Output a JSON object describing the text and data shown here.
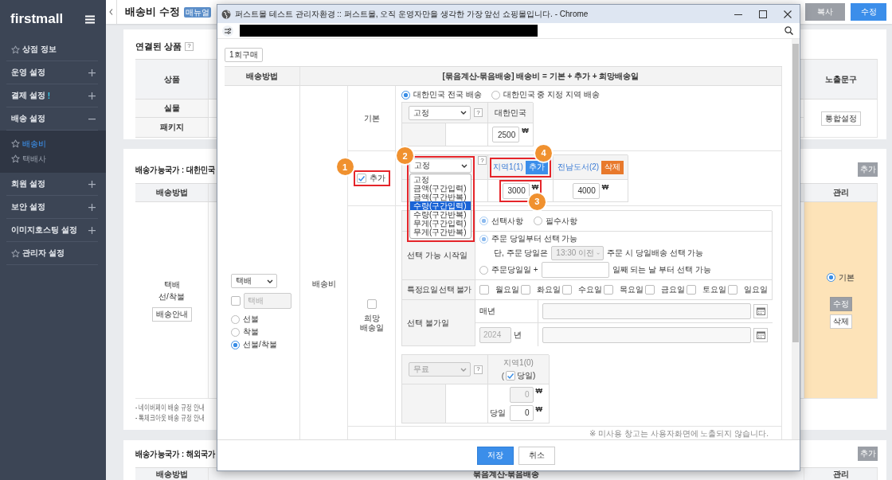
{
  "sidebar": {
    "logo": "firstmall",
    "items": [
      {
        "kind": "link",
        "label": "상점 정보"
      },
      {
        "kind": "group",
        "label": "운영 설정",
        "expanded": false
      },
      {
        "kind": "group",
        "label": "결제 설정",
        "alert": "!",
        "expanded": false
      },
      {
        "kind": "group",
        "label": "배송 설정",
        "expanded": true,
        "children": [
          {
            "label": "배송비",
            "selected": true
          },
          {
            "label": "택배사",
            "selected": false
          }
        ]
      },
      {
        "kind": "group",
        "label": "회원 설정",
        "expanded": false
      },
      {
        "kind": "group",
        "label": "보안 설정",
        "expanded": false
      },
      {
        "kind": "group",
        "label": "이미지호스팅 설정",
        "expanded": false
      },
      {
        "kind": "link",
        "label": "관리자 설정"
      }
    ]
  },
  "header": {
    "title": "배송비 수정",
    "badge": "매뉴얼",
    "buttons": [
      {
        "label": "복사",
        "kind": "secondary"
      },
      {
        "label": "수정",
        "kind": "primary"
      }
    ]
  },
  "linked_products": {
    "title": "연결된 상품",
    "help": "?",
    "columns": [
      "상품",
      "노출문구"
    ],
    "rows": [
      "실물",
      "패키지"
    ],
    "button": "통합설정"
  },
  "domestic": {
    "title": "배송가능국가 : 대한민국",
    "add_button": "추가",
    "columns": [
      "배송방법",
      "관리"
    ],
    "method": {
      "name": "택배",
      "payment": "선/착불",
      "guide_button": "배송안내"
    },
    "manage": {
      "default_option": {
        "label": "기본",
        "selected": true
      },
      "buttons": [
        {
          "label": "수정",
          "kind": "secondary"
        },
        {
          "label": "삭제",
          "kind": "plain"
        }
      ]
    },
    "notes": [
      "- 네이버페이 배송 규정 안내",
      "- 톡체크아웃 배송 규정 안내"
    ]
  },
  "overseas": {
    "title": "배송가능국가 : 해외국가",
    "add_button": "추가",
    "columns": [
      "배송방법",
      "묶음계산-묶음배송",
      "관리"
    ]
  },
  "popup": {
    "title": "퍼스트몰 테스트 관리자환경 :: 퍼스트몰, 오직 운영자만을 생각한 가장 앞선 쇼핑몰입니다. - Chrome",
    "purchase_select": "1회구매",
    "columns": [
      "배송방법",
      "[묶음계산-묶음배송] 배송비 = 기본 + 추가 + 희망배송일"
    ],
    "method": {
      "select": "택배",
      "custom_checked": false,
      "custom_value": "택배",
      "custom_disabled": true,
      "payment_options": [
        {
          "label": "선불",
          "selected": false
        },
        {
          "label": "착불",
          "selected": false
        },
        {
          "label": "선불/착불",
          "selected": true
        }
      ]
    },
    "fee_label": "배송비",
    "basic": {
      "label": "기본",
      "scope_options": [
        {
          "label": "대한민국 전국 배송",
          "selected": true
        },
        {
          "label": "대한민국 중 지정 지역 배송",
          "selected": false
        }
      ],
      "type_select": "고정",
      "help": "?",
      "region": "대한민국",
      "amount": "2500",
      "currency": "₩"
    },
    "extra": {
      "label": "추가",
      "checked": true,
      "type_select": "고정",
      "help": "?",
      "dropdown_open": true,
      "type_options": [
        {
          "label": "고정",
          "selected": false
        },
        {
          "label": "금액(구간입력)",
          "selected": false
        },
        {
          "label": "금액(구간반복)",
          "selected": false
        },
        {
          "label": "수량(구간입력)",
          "selected": true
        },
        {
          "label": "수량(구간반복)",
          "selected": false
        },
        {
          "label": "무게(구간입력)",
          "selected": false
        },
        {
          "label": "무게(구간반복)",
          "selected": false
        }
      ],
      "regions": [
        {
          "name": "지역1(1)",
          "action": {
            "label": "추가",
            "kind": "add"
          },
          "amount": "3000",
          "currency": "₩"
        },
        {
          "name": "전남도서(2)",
          "action": {
            "label": "삭제",
            "kind": "delete"
          },
          "amount": "4000",
          "currency": "₩"
        }
      ]
    },
    "hope_date": {
      "label": "희망 배송일",
      "checked": false,
      "requirement_options": [
        {
          "label": "선택사항",
          "selected": true
        },
        {
          "label": "필수사항",
          "selected": false
        }
      ],
      "start_label": "선택 가능 시작일",
      "start_options": [
        {
          "kind": "same_day",
          "label": "주문 당일부터 선택 가능",
          "selected": true,
          "condition_prefix": "단, 주문 당일은",
          "time_select": "13:30 이전",
          "time_disabled": true,
          "condition_suffix": "주문 시 당일배송 선택 가능"
        },
        {
          "kind": "offset",
          "label": "주문당일일 +",
          "selected": false,
          "suffix": "일째 되는 날 부터 선택 가능"
        }
      ],
      "weekday_label": "특정요일 선택 불가",
      "weekdays": [
        {
          "label": "월요일",
          "checked": false
        },
        {
          "label": "화요일",
          "checked": false
        },
        {
          "label": "수요일",
          "checked": false
        },
        {
          "label": "목요일",
          "checked": false
        },
        {
          "label": "금요일",
          "checked": false
        },
        {
          "label": "토요일",
          "checked": false
        },
        {
          "label": "일요일",
          "checked": false
        }
      ],
      "blocked_label": "선택 불가일",
      "blocked_dates": [
        {
          "kind": "yearly",
          "label": "매년"
        },
        {
          "kind": "year",
          "year": "2024",
          "year_disabled": true,
          "unit": "년"
        }
      ],
      "same_day_fee": {
        "type_select": "무료",
        "type_disabled": true,
        "help": "?",
        "region": "지역1(0)",
        "open_paren": "(",
        "same_day_checked": true,
        "same_day_label": "당일)",
        "amount": "0",
        "amount_disabled": true,
        "currency": "₩",
        "same_day_prefix": "당일",
        "same_day_amount": "0",
        "same_day_currency": "₩"
      }
    },
    "note": "※ 미사용 창고는 사용자화면에 노출되지 않습니다.",
    "buttons": [
      {
        "label": "저장",
        "kind": "primary"
      },
      {
        "label": "취소",
        "kind": "secondary"
      }
    ]
  },
  "annotations": [
    {
      "number": "1"
    },
    {
      "number": "2"
    },
    {
      "number": "3"
    },
    {
      "number": "4"
    }
  ]
}
